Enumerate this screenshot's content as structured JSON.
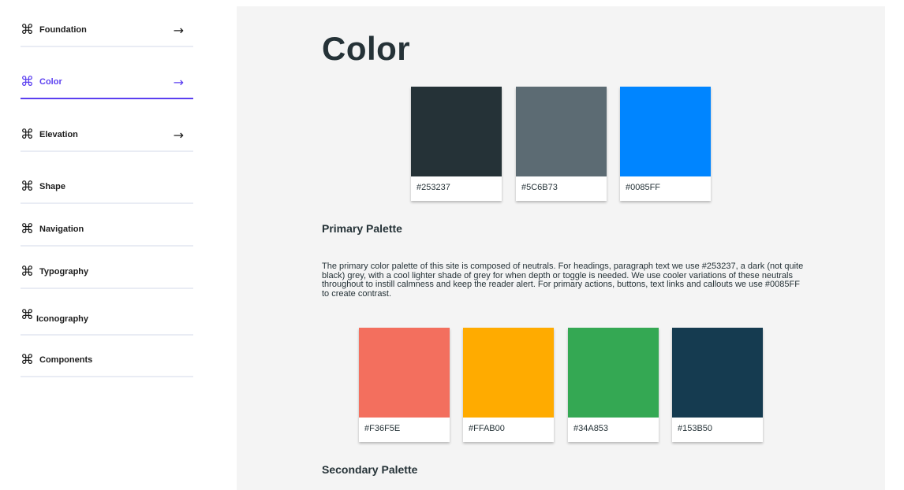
{
  "sidebar": {
    "cmd_glyph": "⌘",
    "arrow_glyph": "→",
    "items": [
      {
        "label": "Foundation",
        "arrow": true,
        "active": false
      },
      {
        "label": "Color",
        "arrow": true,
        "active": true
      },
      {
        "label": "Elevation",
        "arrow": true,
        "active": false
      },
      {
        "label": "Shape",
        "arrow": false,
        "active": false
      },
      {
        "label": "Navigation",
        "arrow": false,
        "active": false
      },
      {
        "label": "Typography",
        "arrow": false,
        "active": false
      },
      {
        "label": "Iconography",
        "arrow": false,
        "active": false
      },
      {
        "label": "Components",
        "arrow": false,
        "active": false
      }
    ]
  },
  "main": {
    "title": "Color",
    "primary_swatches": [
      {
        "code": "#253237",
        "color": "#253237"
      },
      {
        "code": "#5C6B73",
        "color": "#5C6B73"
      },
      {
        "code": "#0085FF",
        "color": "#0085FF"
      }
    ],
    "primary_heading": "Primary Palette",
    "primary_description": "The primary color palette of this site is composed of neutrals. For headings, paragraph text we use #253237, a dark (not quite black) grey, with a cool lighter shade of grey for when depth or toggle is needed. We use cooler variations of these neutrals throughout to instill calmness and keep the reader alert. For primary actions, buttons, text links and callouts we use #0085FF to create contrast.",
    "secondary_swatches": [
      {
        "code": "#F36F5E",
        "color": "#F36F5E"
      },
      {
        "code": "#FFAB00",
        "color": "#FFAB00"
      },
      {
        "code": "#34A853",
        "color": "#34A853"
      },
      {
        "code": "#153B50",
        "color": "#153B50"
      }
    ],
    "secondary_heading": "Secondary Palette"
  },
  "colors": {
    "accent": "#5B3FF0",
    "panel_background": "#F4F4F4",
    "divider": "#E9ECF4"
  }
}
